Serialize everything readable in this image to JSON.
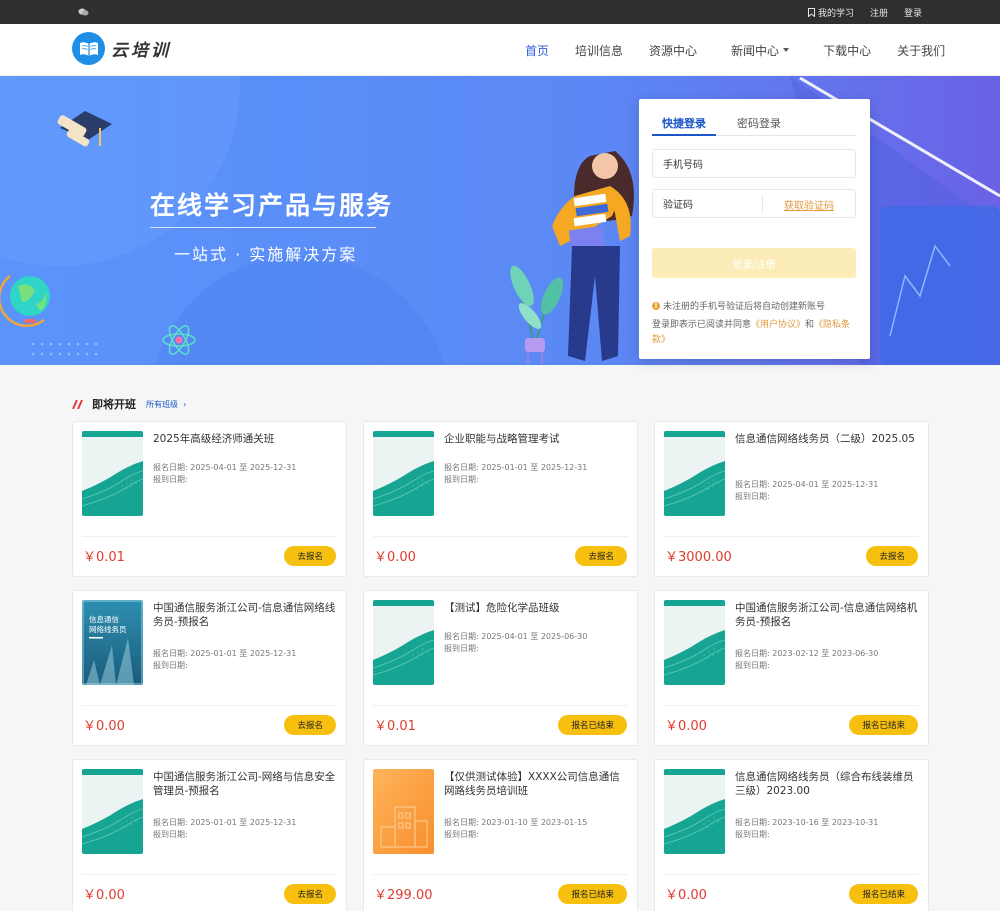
{
  "topbar": {
    "links": [
      "我的学习",
      "注册",
      "登录"
    ]
  },
  "header": {
    "logo_text": "云培训",
    "nav": [
      {
        "label": "首页",
        "active": true
      },
      {
        "label": "培训信息"
      },
      {
        "label": "资源中心"
      },
      {
        "label": "新闻中心",
        "dropdown": true
      },
      {
        "label": "下载中心"
      },
      {
        "label": "关于我们"
      }
    ]
  },
  "banner": {
    "title": "在线学习产品与服务",
    "subtitle": "一站式 · 实施解决方案"
  },
  "login": {
    "tabs": [
      "快捷登录",
      "密码登录"
    ],
    "phone_placeholder": "手机号码",
    "code_placeholder": "验证码",
    "get_code": "获取验证码",
    "submit": "登录/注册",
    "notice": "未注册的手机号验证后将自动创建新账号",
    "agree_prefix": "登录即表示已阅读并同意",
    "agree_user": "《用户协议》",
    "agree_and": "和",
    "agree_privacy": "《隐私条款》"
  },
  "section": {
    "title": "即将开班",
    "more": "所有班级",
    "reg_date_label": "报名日期:",
    "report_date_label": "报到日期:",
    "date_sep": "至"
  },
  "courses": [
    {
      "title": "2025年高级经济师通关班",
      "start": "2025-04-01",
      "end": "2025-12-31",
      "price": "￥0.01",
      "btn": "去报名",
      "thumb": "teal"
    },
    {
      "title": "企业职能与战略管理考试",
      "start": "2025-01-01",
      "end": "2025-12-31",
      "price": "￥0.00",
      "btn": "去报名",
      "thumb": "teal"
    },
    {
      "title": "信息通信网络线务员（二级）2025.05",
      "start": "2025-04-01",
      "end": "2025-12-31",
      "price": "￥3000.00",
      "btn": "去报名",
      "thumb": "teal"
    },
    {
      "title": "中国通信服务浙江公司-信息通信网络线务员-预报名",
      "start": "2025-01-01",
      "end": "2025-12-31",
      "price": "￥0.00",
      "btn": "去报名",
      "thumb": "building",
      "thumb_text": "信息通信网络线务员"
    },
    {
      "title": "【测试】危险化学品班级",
      "start": "2025-04-01",
      "end": "2025-06-30",
      "price": "￥0.01",
      "btn": "报名已结束",
      "thumb": "teal"
    },
    {
      "title": "中国通信服务浙江公司-信息通信网络机务员-预报名",
      "start": "2023-02-12",
      "end": "2023-06-30",
      "price": "￥0.00",
      "btn": "报名已结束",
      "thumb": "teal"
    },
    {
      "title": "中国通信服务浙江公司-网络与信息安全管理员-预报名",
      "start": "2025-01-01",
      "end": "2025-12-31",
      "price": "￥0.00",
      "btn": "去报名",
      "thumb": "teal"
    },
    {
      "title": "【仅供测试体验】XXXX公司信息通信网路线务员培训班",
      "start": "2023-01-10",
      "end": "2023-01-15",
      "price": "￥299.00",
      "btn": "报名已结束",
      "thumb": "orange"
    },
    {
      "title": "信息通信网络线务员（综合布线装维员三级）2023.00",
      "start": "2023-10-16",
      "end": "2023-10-31",
      "price": "￥0.00",
      "btn": "报名已结束",
      "thumb": "teal"
    }
  ],
  "colors": {
    "accent": "#2b5fd9",
    "banner_bg": "#5b8cf7",
    "button_yellow": "#f7c00f",
    "price_red": "#e03b2f"
  }
}
